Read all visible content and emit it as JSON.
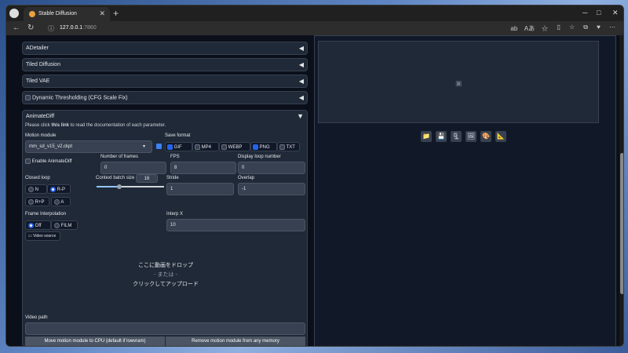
{
  "browser": {
    "tab_title": "Stable Diffusion",
    "url_host": "127.0.0.1",
    "url_port": ":7860",
    "read_aloud_label": "Aあ"
  },
  "accordions": [
    {
      "label": "ADetailer",
      "arrow": "◀"
    },
    {
      "label": "Tiled Diffusion",
      "arrow": "◀"
    },
    {
      "label": "Tiled VAE",
      "arrow": "◀"
    },
    {
      "label": "Dynamic Thresholding (CFG Scale Fix)",
      "arrow": "◀",
      "checkbox": true
    }
  ],
  "animatediff": {
    "title": "AnimateDiff",
    "doc_prefix": "Please click ",
    "doc_link": "this link",
    "doc_suffix": " to read the documentation of each parameter.",
    "motion_module_label": "Motion module",
    "motion_module_value": "mm_sd_v15_v2.ckpt",
    "save_format_label": "Save format",
    "formats": [
      {
        "label": "GIF",
        "checked": true
      },
      {
        "label": "MP4",
        "checked": false
      },
      {
        "label": "WEBP",
        "checked": false
      },
      {
        "label": "PNG",
        "checked": true
      },
      {
        "label": "TXT",
        "checked": false
      }
    ],
    "enable_label": "Enable AnimateDiff",
    "frames_label": "Number of frames",
    "frames_value": "0",
    "fps_label": "FPS",
    "fps_value": "8",
    "loop_number_label": "Display loop number",
    "loop_number_value": "0",
    "closed_loop_label": "Closed loop",
    "closed_loop_options": [
      {
        "label": "N",
        "selected": false
      },
      {
        "label": "R-P",
        "selected": true
      },
      {
        "label": "R+P",
        "selected": false
      },
      {
        "label": "A",
        "selected": false
      }
    ],
    "context_label": "Context batch size",
    "context_value": "16",
    "context_fraction": 0.3333,
    "stride_label": "Stride",
    "stride_value": "1",
    "overlap_label": "Overlap",
    "overlap_value": "-1",
    "frame_interp_label": "Frame Interpolation",
    "frame_interp_options": [
      {
        "label": "Off",
        "selected": true
      },
      {
        "label": "FILM",
        "selected": false
      }
    ],
    "interp_x_label": "Interp X",
    "interp_x_value": "10",
    "video_source_label": "Video source",
    "drop_line1": "ここに動画をドロップ",
    "drop_line2": "- または -",
    "drop_line3": "クリックしてアップロード",
    "video_path_label": "Video path",
    "btn_move": "Move motion module to CPU (default if lowvram)",
    "btn_remove": "Remove motion module from any memory"
  },
  "tools": [
    "folder-icon",
    "save-icon",
    "zip-icon",
    "image-icon",
    "palette-icon",
    "ruler-icon"
  ]
}
